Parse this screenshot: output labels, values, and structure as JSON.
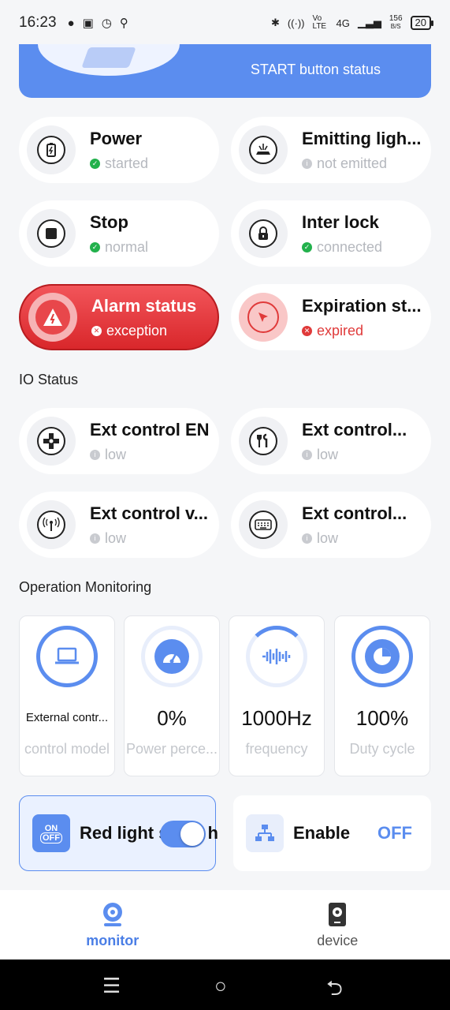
{
  "statusbar": {
    "time": "16:23",
    "net_speed": "156",
    "net_unit": "B/S",
    "network": "4G",
    "volte": "Vo LTE",
    "battery": "20"
  },
  "banner": {
    "text": "START button status"
  },
  "status_cards": [
    {
      "title": "Power",
      "status": "started",
      "state": "ok",
      "icon": "battery-icon"
    },
    {
      "title": "Emitting ligh...",
      "status": "not emitted",
      "state": "info",
      "icon": "laser-emit-icon"
    },
    {
      "title": "Stop",
      "status": "normal",
      "state": "ok",
      "icon": "stop-icon"
    },
    {
      "title": "Inter lock",
      "status": "connected",
      "state": "ok",
      "icon": "lock-icon"
    },
    {
      "title": "Alarm status",
      "status": "exception",
      "state": "alarm",
      "icon": "warning-icon"
    },
    {
      "title": "Expiration st...",
      "status": "expired",
      "state": "error",
      "icon": "cursor-icon"
    }
  ],
  "io_section": {
    "title": "IO Status"
  },
  "io_cards": [
    {
      "title": "Ext control EN",
      "status": "low",
      "icon": "gamepad-icon"
    },
    {
      "title": "Ext control...",
      "status": "low",
      "icon": "tools-icon"
    },
    {
      "title": "Ext control v...",
      "status": "low",
      "icon": "antenna-icon"
    },
    {
      "title": "Ext control...",
      "status": "low",
      "icon": "keyboard-icon"
    }
  ],
  "monitor_section": {
    "title": "Operation Monitoring"
  },
  "monitors": [
    {
      "value": "External contr...",
      "label": "control model",
      "icon": "laptop-icon"
    },
    {
      "value": "0%",
      "label": "Power perce...",
      "icon": "speedometer-icon"
    },
    {
      "value": "1000Hz",
      "label": "frequency",
      "icon": "waveform-icon"
    },
    {
      "value": "100%",
      "label": "Duty cycle",
      "icon": "pie-chart-icon"
    }
  ],
  "red_light": {
    "icon_text_top": "ON",
    "icon_text_bottom": "OFF",
    "label": "Red light s",
    "label_tail": "h",
    "on": true
  },
  "enable": {
    "label": "Enable",
    "value": "OFF"
  },
  "tabs": [
    {
      "label": "monitor",
      "active": true,
      "icon": "webcam-icon"
    },
    {
      "label": "device",
      "active": false,
      "icon": "device-icon"
    }
  ],
  "colors": {
    "accent": "#5b8def",
    "ok": "#22b14c",
    "alarm": "#e03a3a"
  }
}
